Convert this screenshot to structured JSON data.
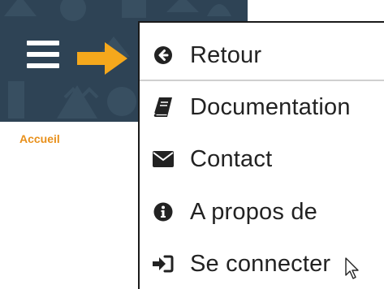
{
  "header": {
    "menu_icon": "hamburger-icon",
    "callout_icon": "arrow-right-icon",
    "colors": {
      "background": "#2e4355",
      "callout": "#f5a81c"
    }
  },
  "breadcrumb": {
    "label": "Accueil",
    "color": "#e8901b"
  },
  "menu": {
    "items": [
      {
        "label": "Retour",
        "icon": "arrow-left-circle-icon"
      },
      {
        "label": "Documentation",
        "icon": "book-icon"
      },
      {
        "label": "Contact",
        "icon": "envelope-icon"
      },
      {
        "label": "A propos de",
        "icon": "info-circle-icon"
      },
      {
        "label": "Se connecter",
        "icon": "sign-in-icon"
      }
    ]
  },
  "pointer": {
    "icon": "mouse-pointer-icon"
  }
}
